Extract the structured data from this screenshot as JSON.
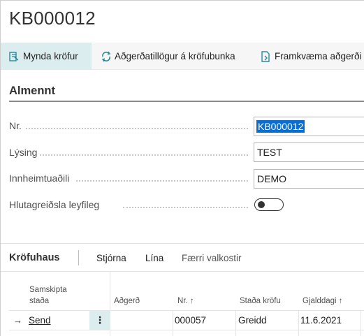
{
  "page": {
    "title": "KB000012"
  },
  "actions": [
    {
      "label": "Mynda kröfur",
      "icon": "create-claims-icon"
    },
    {
      "label": "Aðgerðatillögur á kröfubunka",
      "icon": "suggest-actions-icon"
    },
    {
      "label": "Framkvæma aðgerði",
      "icon": "execute-action-icon"
    }
  ],
  "general": {
    "title": "Almennt",
    "fields": {
      "nr": {
        "label": "Nr.",
        "value": "KB000012"
      },
      "description": {
        "label": "Lýsing",
        "value": "TEST"
      },
      "collector": {
        "label": "Innheimtuaðili",
        "value": "DEMO"
      },
      "partial_payment": {
        "label": "Hlutagreiðsla leyfileg",
        "enabled": false
      }
    }
  },
  "subpage": {
    "title": "Kröfuhaus",
    "actions": {
      "manage": "Stjórna",
      "line": "Lína",
      "fewer": "Færri valkostir"
    },
    "columns": {
      "status_line1": "Samskipta",
      "status_line2": "staða",
      "action": "Aðgerð",
      "nr": "Nr. ↑",
      "claim_status": "Staða kröfu",
      "due_date": "Gjalddagi ↑"
    },
    "rows": [
      {
        "status": "Send",
        "action": "",
        "nr": "000057",
        "claim_status": "Greidd",
        "due_date": "11.6.2021"
      }
    ]
  }
}
